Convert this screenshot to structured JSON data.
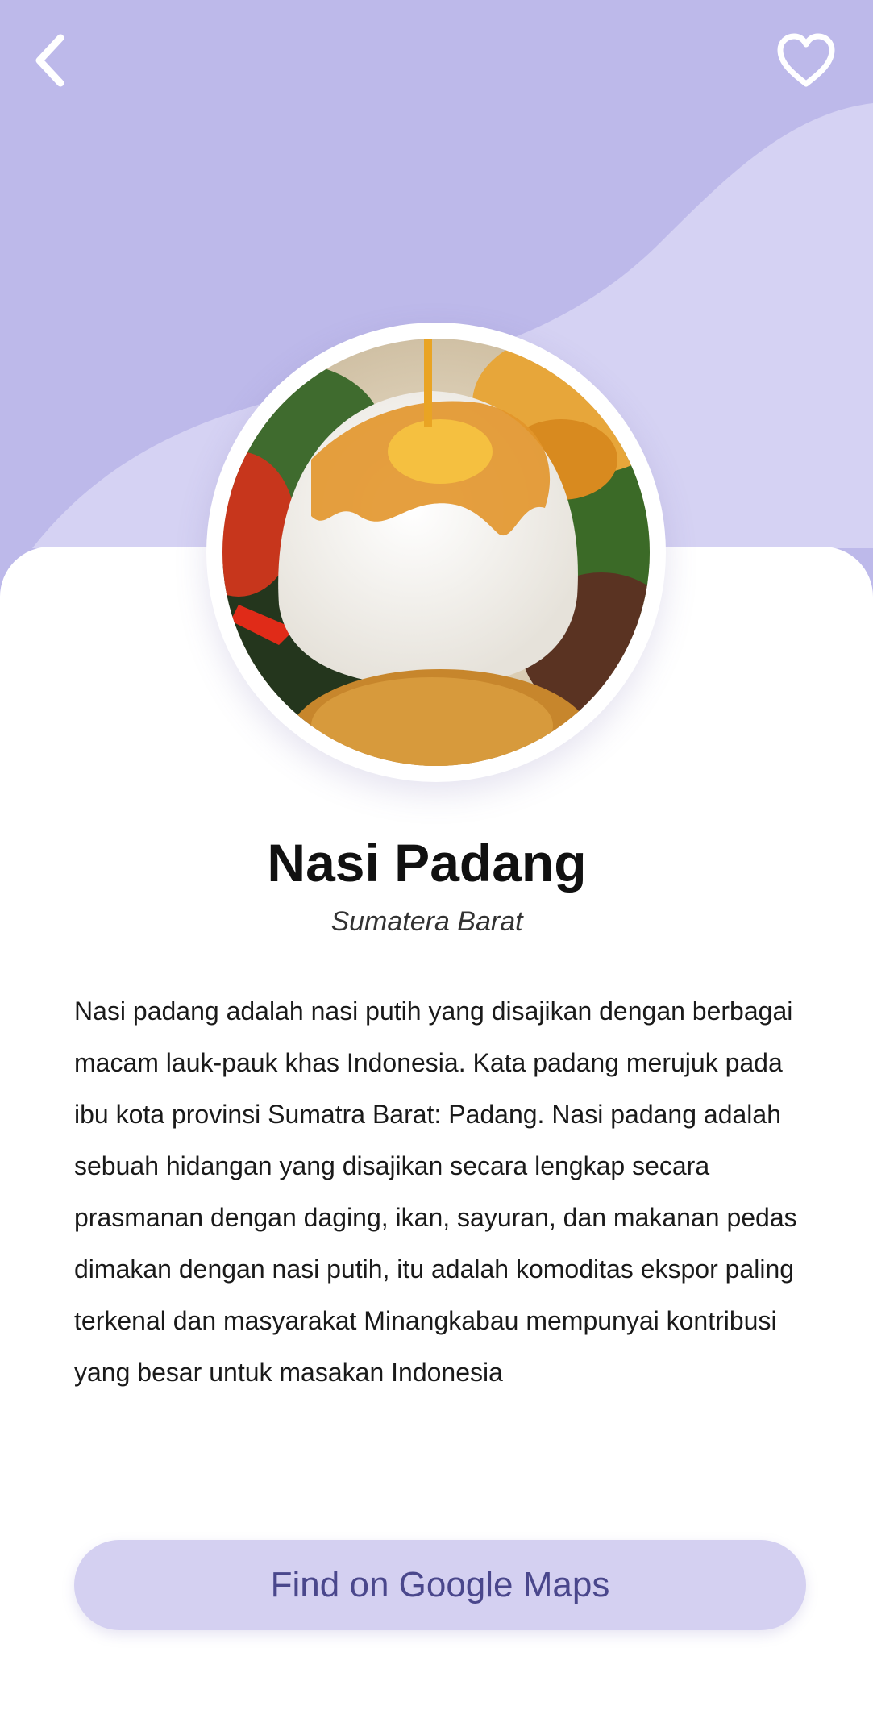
{
  "header": {
    "back_icon": "chevron-left-icon",
    "favorite_icon": "heart-outline-icon"
  },
  "colors": {
    "background": "#bdb9ea",
    "wave": "#d5d2f3",
    "card": "#ffffff",
    "button_bg": "#d4d0f1",
    "button_text": "#4a478c"
  },
  "food": {
    "name": "Nasi Padang",
    "region": "Sumatera Barat",
    "description": "Nasi padang adalah nasi putih yang disajikan dengan berbagai macam lauk-pauk khas Indonesia. Kata padang merujuk pada ibu kota provinsi Sumatra Barat: Padang. Nasi padang adalah sebuah hidangan yang disajikan secara lengkap secara prasmanan dengan daging, ikan, sayuran, dan makanan pedas dimakan dengan nasi putih, itu adalah komoditas ekspor paling terkenal dan masyarakat Minangkabau mempunyai kontribusi yang besar untuk masakan Indonesia"
  },
  "actions": {
    "maps_button_label": "Find on Google Maps"
  }
}
